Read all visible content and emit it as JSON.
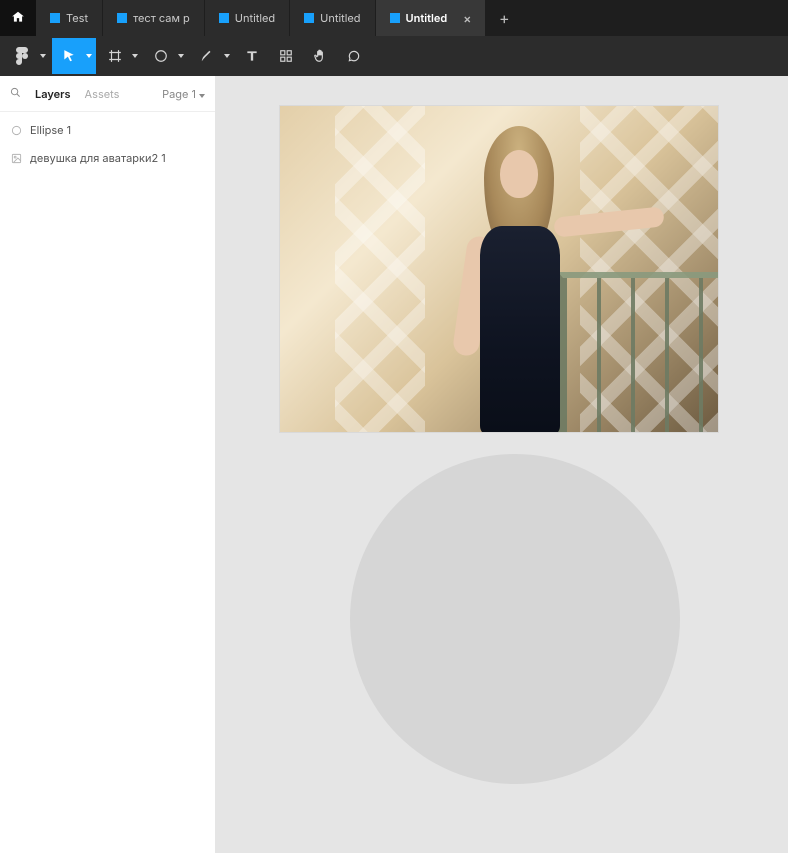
{
  "tabs": {
    "items": [
      {
        "label": "Test"
      },
      {
        "label": "тест сам р"
      },
      {
        "label": "Untitled"
      },
      {
        "label": "Untitled"
      },
      {
        "label": "Untitled"
      }
    ],
    "active_index": 4,
    "close_glyph": "×",
    "new_glyph": "+"
  },
  "toolbar": {
    "menu_icon": "figma-logo",
    "tools": [
      "move",
      "frame",
      "shape",
      "pen",
      "text",
      "resources",
      "hand",
      "comment"
    ],
    "active_tool": "move"
  },
  "left_panel": {
    "tabs": {
      "layers": "Layers",
      "assets": "Assets"
    },
    "active_tab": "layers",
    "page_label": "Page 1",
    "layers": [
      {
        "icon": "ellipse",
        "label": "Ellipse 1"
      },
      {
        "icon": "image",
        "label": "девушка для аватарки2 1"
      }
    ]
  },
  "canvas": {
    "image_layer_name": "девушка для аватарки2 1",
    "ellipse_layer_name": "Ellipse 1"
  }
}
